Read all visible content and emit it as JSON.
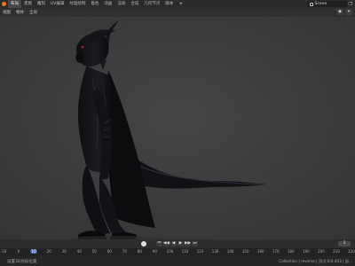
{
  "menu": {
    "tabs": [
      "布局",
      "建模",
      "雕刻",
      "UV编辑",
      "纹理绘制",
      "着色",
      "动画",
      "渲染",
      "合成",
      "几何节点",
      "脚本"
    ],
    "active_tab": 0,
    "add_tab": "+",
    "scene_name": "Scene"
  },
  "header": {
    "items": [
      "视图",
      "物体",
      "全局"
    ]
  },
  "viewport": {
    "background": "#3c3c3c",
    "subject": "dark-creature-model"
  },
  "timeline": {
    "current_frame": "1",
    "ticks": [
      "-10",
      "0",
      "10",
      "20",
      "30",
      "40",
      "50",
      "60",
      "70",
      "80",
      "90",
      "100",
      "110",
      "120",
      "130",
      "140",
      "150",
      "160",
      "170",
      "180",
      "190",
      "200",
      "210",
      "220"
    ],
    "current_tick": "10"
  },
  "status": {
    "left": "设置3D光标位置",
    "right": "Collection | reverse | 顶点:0/4,443 | 面..."
  },
  "colors": {
    "accent": "#4772b3",
    "logo": "#e87d0d"
  }
}
